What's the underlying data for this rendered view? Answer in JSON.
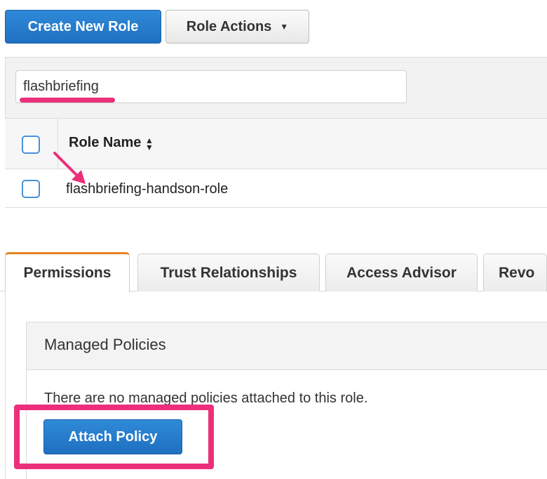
{
  "toolbar": {
    "create_label": "Create New Role",
    "actions_label": "Role Actions"
  },
  "filter": {
    "value": "flashbriefing"
  },
  "table": {
    "columns": [
      "Role Name"
    ],
    "rows": [
      {
        "role_name": "flashbriefing-handson-role"
      }
    ]
  },
  "tabs": [
    {
      "label": "Permissions",
      "active": true
    },
    {
      "label": "Trust Relationships",
      "active": false
    },
    {
      "label": "Access Advisor",
      "active": false
    },
    {
      "label": "Revo",
      "active": false
    }
  ],
  "managed_policies": {
    "title": "Managed Policies",
    "empty_text": "There are no managed policies attached to this role.",
    "attach_label": "Attach Policy"
  },
  "colors": {
    "primary_button": "#1f6fc0",
    "annotation": "#ec2f7a",
    "active_tab_accent": "#e8821f"
  },
  "icons": {
    "caret": "caret-down-icon",
    "sort": "sort-icon",
    "arrow": "annotation-arrow"
  }
}
